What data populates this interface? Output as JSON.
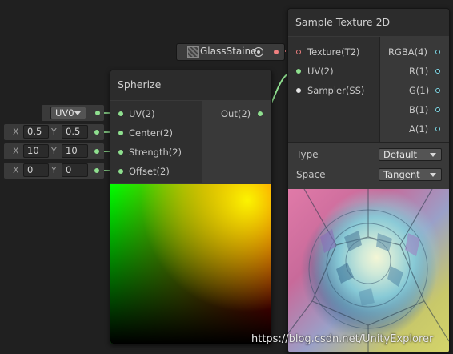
{
  "spherize": {
    "title": "Spherize",
    "inputs": [
      "UV(2)",
      "Center(2)",
      "Strength(2)",
      "Offset(2)"
    ],
    "output": "Out(2)"
  },
  "sample_texture": {
    "title": "Sample Texture 2D",
    "inputs": [
      "Texture(T2)",
      "UV(2)",
      "Sampler(SS)"
    ],
    "outputs": [
      "RGBA(4)",
      "R(1)",
      "G(1)",
      "B(1)",
      "A(1)"
    ],
    "type_label": "Type",
    "type_value": "Default",
    "space_label": "Space",
    "space_value": "Tangent"
  },
  "inline_inputs": {
    "uv_channel": "UV0",
    "center": {
      "x_label": "X",
      "x": "0.5",
      "y_label": "Y",
      "y": "0.5"
    },
    "strength": {
      "x_label": "X",
      "x": "10",
      "y_label": "Y",
      "y": "10"
    },
    "offset": {
      "x_label": "X",
      "x": "0",
      "y_label": "Y",
      "y": "0"
    }
  },
  "texture_property": {
    "name": "GlassStaine"
  },
  "watermark": "https://blog.csdn.net/UnityExplorer"
}
